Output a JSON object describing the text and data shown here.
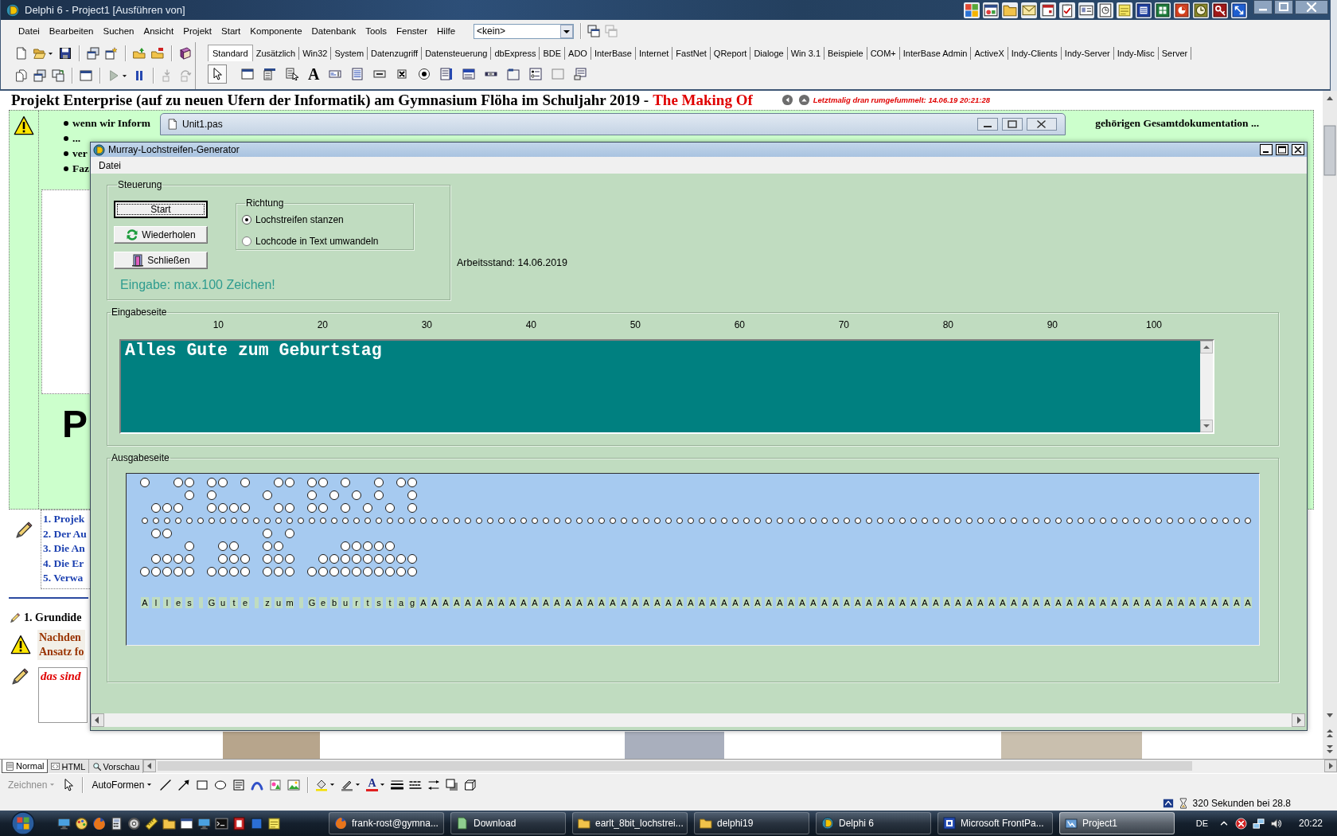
{
  "ide": {
    "title": "Delphi 6 - Project1 [Ausführen von]",
    "menu": [
      "Datei",
      "Bearbeiten",
      "Suchen",
      "Ansicht",
      "Projekt",
      "Start",
      "Komponente",
      "Datenbank",
      "Tools",
      "Fenster",
      "Hilfe"
    ],
    "target_combo": {
      "value": "<kein>"
    },
    "debug_buttons": [
      {
        "disabled": true
      },
      {
        "disabled": false
      },
      {
        "disabled": true
      },
      {
        "disabled": true
      }
    ],
    "palette_tabs": [
      {
        "label": "Standard",
        "selected": true
      },
      {
        "label": "Zusätzlich",
        "selected": false
      },
      {
        "label": "Win32",
        "selected": false
      },
      {
        "label": "System",
        "selected": false
      },
      {
        "label": "Datenzugriff",
        "selected": false
      },
      {
        "label": "Datensteuerung",
        "selected": false
      },
      {
        "label": "dbExpress",
        "selected": false
      },
      {
        "label": "BDE",
        "selected": false
      },
      {
        "label": "ADO",
        "selected": false
      },
      {
        "label": "InterBase",
        "selected": false
      },
      {
        "label": "Internet",
        "selected": false
      },
      {
        "label": "FastNet",
        "selected": false
      },
      {
        "label": "QReport",
        "selected": false
      },
      {
        "label": "Dialoge",
        "selected": false
      },
      {
        "label": "Win 3.1",
        "selected": false
      },
      {
        "label": "Beispiele",
        "selected": false
      },
      {
        "label": "COM+",
        "selected": false
      },
      {
        "label": "InterBase Admin",
        "selected": false
      },
      {
        "label": "ActiveX",
        "selected": false
      },
      {
        "label": "Indy-Clients",
        "selected": false
      },
      {
        "label": "Indy-Server",
        "selected": false
      },
      {
        "label": "Indy-Misc",
        "selected": false
      },
      {
        "label": "Server",
        "selected": false
      }
    ],
    "label_glyph": "A"
  },
  "document": {
    "heading": "Projekt Enterprise (auf zu neuen Ufern der Informatik) am Gymnasium Flöha im Schuljahr 2019 -",
    "heading_highlight": "The Making Of",
    "last_edit": "Letztmalig dran rumgefummelt: 14.06.19 20:21:28",
    "bullets": [
      "wenn wir Inform",
      "...",
      "ver",
      "Faz"
    ],
    "bullet_tail": "gehörigen Gesamtdokumentation ...",
    "big_letter": "P",
    "toc": [
      "1. Projek",
      "2. Der Au",
      "3. Die An",
      "4. Die Er",
      "5. Verwa"
    ],
    "section": "1. Grundide",
    "note_lines": [
      "Nachden",
      "Ansatz fo"
    ],
    "red_note": "das sind"
  },
  "editor_window": {
    "title": "Unit1.pas"
  },
  "dialog": {
    "title": "Murray-Lochstreifen-Generator",
    "menu": [
      "Datei"
    ],
    "controls": {
      "title": "Steuerung",
      "buttons": [
        {
          "label": "Start",
          "kind": "plain",
          "focused": true
        },
        {
          "label": "Wiederholen",
          "kind": "refresh",
          "focused": false
        },
        {
          "label": "Schließen",
          "kind": "exit",
          "focused": false
        }
      ],
      "hint": "Eingabe: max.100 Zeichen!"
    },
    "direction": {
      "title": "Richtung",
      "options": [
        {
          "label": "Lochstreifen stanzen",
          "selected": true
        },
        {
          "label": "Lochcode in Text umwandeln",
          "selected": false
        }
      ]
    },
    "status": "Arbeitsstand: 14.06.2019",
    "input": {
      "title": "Eingabeseite",
      "ruler": [
        "10",
        "20",
        "30",
        "40",
        "50",
        "60",
        "70",
        "80",
        "90",
        "100"
      ],
      "value": "Alles Gute zum Geburtstag"
    },
    "output": {
      "title": "Ausgabeseite",
      "columns": [
        {
          "kind": "char",
          "char": "A",
          "track_1": true,
          "track_7": true
        },
        {
          "kind": "char",
          "char": "l",
          "track_3": true,
          "track_4": true,
          "track_6": true,
          "track_7": true
        },
        {
          "kind": "char",
          "char": "l",
          "track_3": true,
          "track_4": true,
          "track_6": true,
          "track_7": true
        },
        {
          "kind": "char",
          "char": "e",
          "track_1": true,
          "track_3": true,
          "track_6": true,
          "track_7": true
        },
        {
          "kind": "char",
          "char": "s",
          "track_1": true,
          "track_2": true,
          "track_5": true,
          "track_6": true,
          "track_7": true
        },
        {
          "kind": "space"
        },
        {
          "kind": "char",
          "char": "G",
          "track_1": true,
          "track_2": true,
          "track_3": true,
          "track_7": true
        },
        {
          "kind": "char",
          "char": "u",
          "track_1": true,
          "track_3": true,
          "track_5": true,
          "track_6": true,
          "track_7": true
        },
        {
          "kind": "char",
          "char": "t",
          "track_3": true,
          "track_5": true,
          "track_6": true,
          "track_7": true
        },
        {
          "kind": "char",
          "char": "e",
          "track_1": true,
          "track_3": true,
          "track_6": true,
          "track_7": true
        },
        {
          "kind": "space"
        },
        {
          "kind": "char",
          "char": "z",
          "track_2": true,
          "track_4": true,
          "track_5": true,
          "track_6": true,
          "track_7": true
        },
        {
          "kind": "char",
          "char": "u",
          "track_1": true,
          "track_3": true,
          "track_5": true,
          "track_6": true,
          "track_7": true
        },
        {
          "kind": "char",
          "char": "m",
          "track_1": true,
          "track_3": true,
          "track_4": true,
          "track_6": true,
          "track_7": true
        },
        {
          "kind": "space"
        },
        {
          "kind": "char",
          "char": "G",
          "track_1": true,
          "track_2": true,
          "track_3": true,
          "track_7": true
        },
        {
          "kind": "char",
          "char": "e",
          "track_1": true,
          "track_3": true,
          "track_6": true,
          "track_7": true
        },
        {
          "kind": "char",
          "char": "b",
          "track_2": true,
          "track_6": true,
          "track_7": true
        },
        {
          "kind": "char",
          "char": "u",
          "track_1": true,
          "track_3": true,
          "track_5": true,
          "track_6": true,
          "track_7": true
        },
        {
          "kind": "char",
          "char": "r",
          "track_2": true,
          "track_5": true,
          "track_6": true,
          "track_7": true
        },
        {
          "kind": "char",
          "char": "t",
          "track_3": true,
          "track_5": true,
          "track_6": true,
          "track_7": true
        },
        {
          "kind": "char",
          "char": "s",
          "track_1": true,
          "track_2": true,
          "track_5": true,
          "track_6": true,
          "track_7": true
        },
        {
          "kind": "char",
          "char": "t",
          "track_3": true,
          "track_5": true,
          "track_6": true,
          "track_7": true
        },
        {
          "kind": "char",
          "char": "a",
          "track_1": true,
          "track_6": true,
          "track_7": true
        },
        {
          "kind": "char",
          "char": "g",
          "track_1": true,
          "track_2": true,
          "track_3": true,
          "track_6": true,
          "track_7": true
        },
        {
          "kind": "char",
          "char": "A"
        },
        {
          "kind": "char",
          "char": "A"
        },
        {
          "kind": "char",
          "char": "A"
        },
        {
          "kind": "char",
          "char": "A"
        },
        {
          "kind": "char",
          "char": "A"
        },
        {
          "kind": "char",
          "char": "A"
        },
        {
          "kind": "char",
          "char": "A"
        },
        {
          "kind": "char",
          "char": "A"
        },
        {
          "kind": "char",
          "char": "A"
        },
        {
          "kind": "char",
          "char": "A"
        },
        {
          "kind": "char",
          "char": "A"
        },
        {
          "kind": "char",
          "char": "A"
        },
        {
          "kind": "char",
          "char": "A"
        },
        {
          "kind": "char",
          "char": "A"
        },
        {
          "kind": "char",
          "char": "A"
        },
        {
          "kind": "char",
          "char": "A"
        },
        {
          "kind": "char",
          "char": "A"
        },
        {
          "kind": "char",
          "char": "A"
        },
        {
          "kind": "char",
          "char": "A"
        },
        {
          "kind": "char",
          "char": "A"
        },
        {
          "kind": "char",
          "char": "A"
        },
        {
          "kind": "char",
          "char": "A"
        },
        {
          "kind": "char",
          "char": "A"
        },
        {
          "kind": "char",
          "char": "A"
        },
        {
          "kind": "char",
          "char": "A"
        },
        {
          "kind": "char",
          "char": "A"
        },
        {
          "kind": "char",
          "char": "A"
        },
        {
          "kind": "char",
          "char": "A"
        },
        {
          "kind": "char",
          "char": "A"
        },
        {
          "kind": "char",
          "char": "A"
        },
        {
          "kind": "char",
          "char": "A"
        },
        {
          "kind": "char",
          "char": "A"
        },
        {
          "kind": "char",
          "char": "A"
        },
        {
          "kind": "char",
          "char": "A"
        },
        {
          "kind": "char",
          "char": "A"
        },
        {
          "kind": "char",
          "char": "A"
        },
        {
          "kind": "char",
          "char": "A"
        },
        {
          "kind": "char",
          "char": "A"
        },
        {
          "kind": "char",
          "char": "A"
        },
        {
          "kind": "char",
          "char": "A"
        },
        {
          "kind": "char",
          "char": "A"
        },
        {
          "kind": "char",
          "char": "A"
        },
        {
          "kind": "char",
          "char": "A"
        },
        {
          "kind": "char",
          "char": "A"
        },
        {
          "kind": "char",
          "char": "A"
        },
        {
          "kind": "char",
          "char": "A"
        },
        {
          "kind": "char",
          "char": "A"
        },
        {
          "kind": "char",
          "char": "A"
        },
        {
          "kind": "char",
          "char": "A"
        },
        {
          "kind": "char",
          "char": "A"
        },
        {
          "kind": "char",
          "char": "A"
        },
        {
          "kind": "char",
          "char": "A"
        },
        {
          "kind": "char",
          "char": "A"
        },
        {
          "kind": "char",
          "char": "A"
        },
        {
          "kind": "char",
          "char": "A"
        },
        {
          "kind": "char",
          "char": "A"
        },
        {
          "kind": "char",
          "char": "A"
        },
        {
          "kind": "char",
          "char": "A"
        },
        {
          "kind": "char",
          "char": "A"
        },
        {
          "kind": "char",
          "char": "A"
        },
        {
          "kind": "char",
          "char": "A"
        },
        {
          "kind": "char",
          "char": "A"
        },
        {
          "kind": "char",
          "char": "A"
        },
        {
          "kind": "char",
          "char": "A"
        },
        {
          "kind": "char",
          "char": "A"
        },
        {
          "kind": "char",
          "char": "A"
        },
        {
          "kind": "char",
          "char": "A"
        },
        {
          "kind": "char",
          "char": "A"
        },
        {
          "kind": "char",
          "char": "A"
        },
        {
          "kind": "char",
          "char": "A"
        },
        {
          "kind": "char",
          "char": "A"
        },
        {
          "kind": "char",
          "char": "A"
        },
        {
          "kind": "char",
          "char": "A"
        },
        {
          "kind": "char",
          "char": "A"
        },
        {
          "kind": "char",
          "char": "A"
        }
      ]
    }
  },
  "frontpage": {
    "views": [
      {
        "label": "Normal",
        "selected": true
      },
      {
        "label": "HTML",
        "selected": false
      },
      {
        "label": "Vorschau",
        "selected": false
      }
    ],
    "draw_menu": {
      "label": "Zeichnen",
      "disabled": true
    },
    "autoshapes_menu": {
      "label": "AutoFormen",
      "disabled": false
    },
    "font_color_glyph": "A",
    "status": "320 Sekunden bei 28.8"
  },
  "taskbar": {
    "tasks": [
      {
        "label": "frank-rost@gymna...",
        "selected": false
      },
      {
        "label": "Download",
        "selected": false
      },
      {
        "label": "earlt_8bit_lochstrei...",
        "selected": false
      },
      {
        "label": "delphi19",
        "selected": false
      },
      {
        "label": "Delphi 6",
        "selected": false
      },
      {
        "label": "Microsoft FrontPa...",
        "selected": false
      },
      {
        "label": "Project1",
        "selected": true
      }
    ],
    "language": "DE",
    "time": "20:22"
  }
}
